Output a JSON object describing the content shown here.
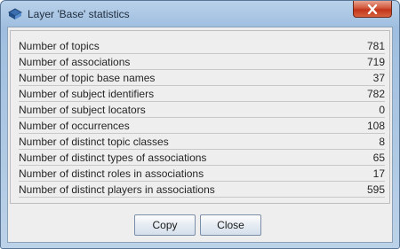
{
  "window": {
    "title": "Layer 'Base' statistics",
    "icon": "topic-map-icon",
    "close_icon": "close-icon"
  },
  "stats": [
    {
      "label": "Number of topics",
      "value": "781"
    },
    {
      "label": "Number of associations",
      "value": "719"
    },
    {
      "label": "Number of topic base names",
      "value": "37"
    },
    {
      "label": "Number of subject identifiers",
      "value": "782"
    },
    {
      "label": "Number of subject locators",
      "value": "0"
    },
    {
      "label": "Number of occurrences",
      "value": "108"
    },
    {
      "label": "Number of distinct topic classes",
      "value": "8"
    },
    {
      "label": "Number of distinct types of associations",
      "value": "65"
    },
    {
      "label": "Number of distinct roles in associations",
      "value": "17"
    },
    {
      "label": "Number of distinct players in associations",
      "value": "595"
    }
  ],
  "buttons": {
    "copy_label": "Copy",
    "close_label": "Close"
  }
}
